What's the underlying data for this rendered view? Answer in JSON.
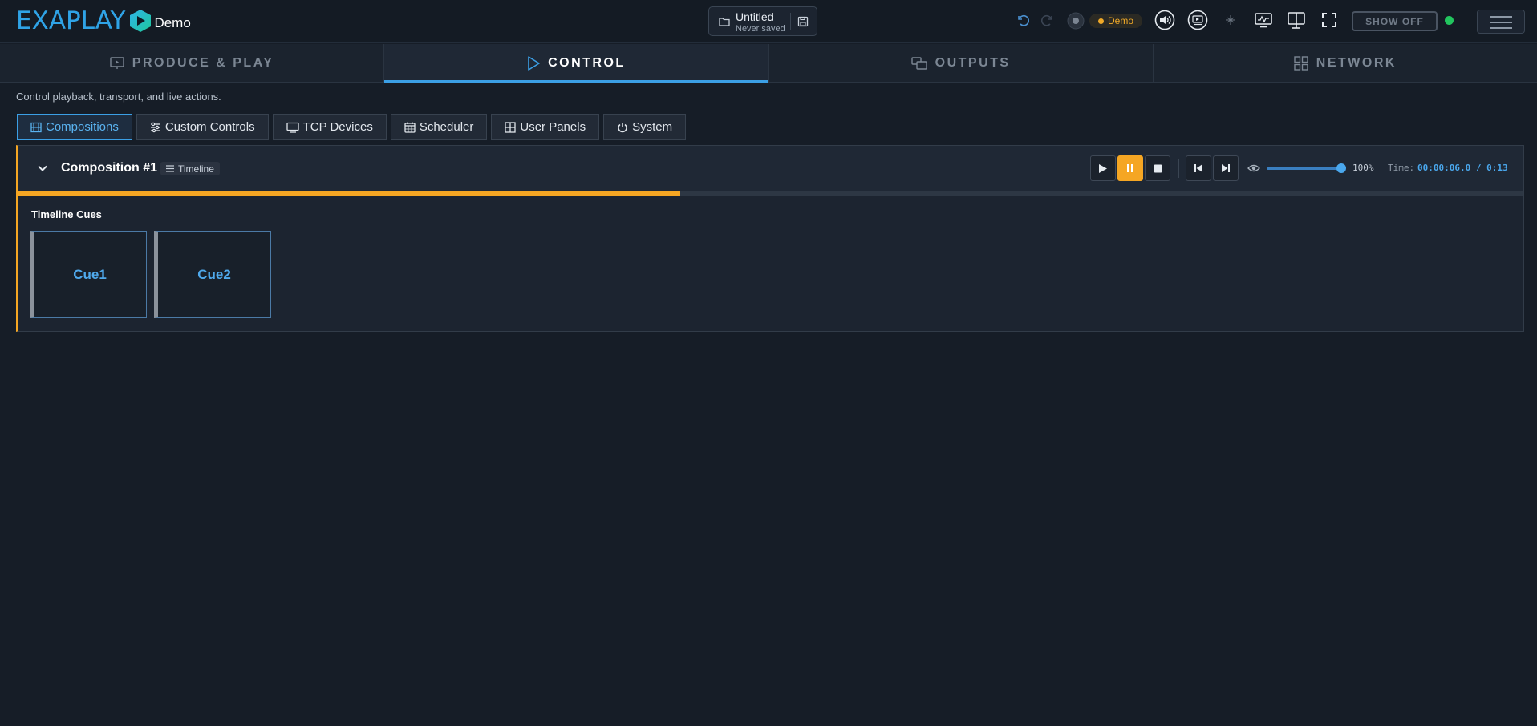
{
  "header": {
    "logo_text": "EXAPLAY",
    "logo_suffix": "Demo",
    "file": {
      "name": "Untitled",
      "status": "Never saved"
    },
    "demo_badge": "Demo",
    "show_toggle": "SHOW OFF",
    "status_color": "#22c55e"
  },
  "main_tabs": [
    {
      "label": "PRODUCE & PLAY",
      "icon": "presentation-icon",
      "active": false
    },
    {
      "label": "CONTROL",
      "icon": "play-icon",
      "active": true
    },
    {
      "label": "OUTPUTS",
      "icon": "outputs-icon",
      "active": false
    },
    {
      "label": "NETWORK",
      "icon": "grid-icon",
      "active": false
    }
  ],
  "subtitle": "Control playback, transport, and live actions.",
  "sub_tabs": [
    {
      "label": "Compositions",
      "icon": "film-icon",
      "active": true
    },
    {
      "label": "Custom Controls",
      "icon": "sliders-icon",
      "active": false
    },
    {
      "label": "TCP Devices",
      "icon": "monitor-icon",
      "active": false
    },
    {
      "label": "Scheduler",
      "icon": "calendar-icon",
      "active": false
    },
    {
      "label": "User Panels",
      "icon": "panels-icon",
      "active": false
    },
    {
      "label": "System",
      "icon": "power-icon",
      "active": false
    }
  ],
  "composition": {
    "title": "Composition #1",
    "mode": "Timeline",
    "volume_label": "100%",
    "volume": 1.0,
    "time_label": "Time:",
    "time_value": "00:00:06.0 / 0:13",
    "progress": 0.44,
    "cues_title": "Timeline Cues",
    "cues": [
      {
        "label": "Cue1"
      },
      {
        "label": "Cue2"
      }
    ]
  },
  "colors": {
    "accent": "#3b9fe5",
    "playing": "#f5a623",
    "background": "#161d27"
  }
}
